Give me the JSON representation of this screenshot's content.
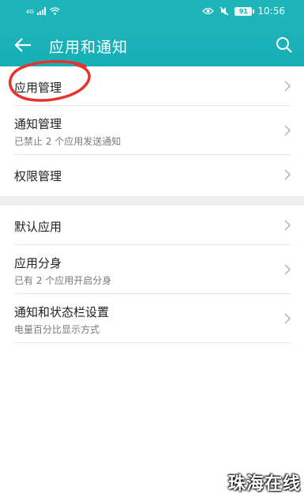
{
  "status_bar": {
    "signal_text": "4G",
    "battery": "91",
    "time": "10:56"
  },
  "header": {
    "title": "应用和通知",
    "back_icon": "arrow-left-icon",
    "search_icon": "search-icon",
    "background_color": "#17afb6"
  },
  "group1": [
    {
      "label": "应用管理",
      "sub": ""
    },
    {
      "label": "通知管理",
      "sub": "已禁止 2 个应用发送通知"
    },
    {
      "label": "权限管理",
      "sub": ""
    }
  ],
  "group2": [
    {
      "label": "默认应用",
      "sub": ""
    },
    {
      "label": "应用分身",
      "sub": "已有 2 个应用开启分身"
    },
    {
      "label": "通知和状态栏设置",
      "sub": "电量百分比显示方式"
    }
  ],
  "annotation_color": "#e8322c",
  "watermark": "珠海在线"
}
